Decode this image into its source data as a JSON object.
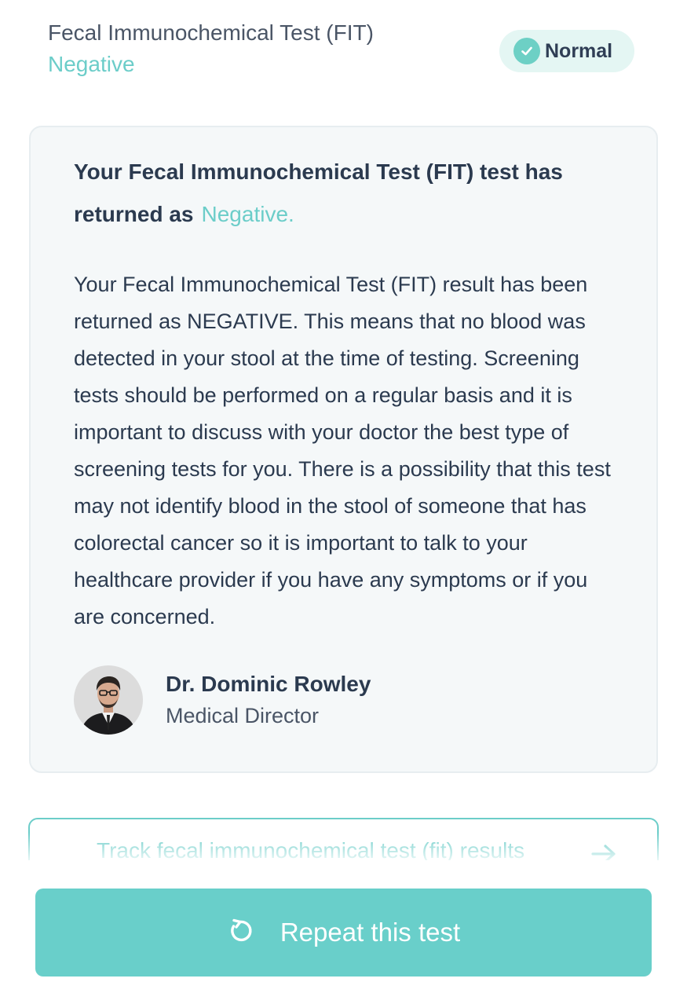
{
  "result_header": {
    "test_name": "Fecal Immunochemical Test (FIT)",
    "result": "Negative",
    "status_badge": "Normal"
  },
  "result_card": {
    "title_prefix": "Your Fecal Immunochemical Test (FIT) test has returned as",
    "title_result": "Negative.",
    "body": "Your Fecal Immunochemical Test (FIT) result has been returned as NEGATIVE. This means that no blood was detected in your stool at the time of testing. Screening tests should be performed on a regular basis and it is important to discuss with your doctor the best type of screening tests for you. There is a possibility that this test may not identify blood in the stool of someone that has colorectal cancer so it is important to talk to your healthcare provider if you have any symptoms or if you are concerned.",
    "doctor": {
      "name": "Dr. Dominic Rowley",
      "role": "Medical Director"
    }
  },
  "actions": {
    "track_label": "Track fecal immunochemical test (fit) results",
    "repeat_label": "Repeat this test"
  },
  "icons": {
    "badge": "check-circle-icon",
    "track": "arrow-right-icon",
    "repeat": "refresh-icon"
  },
  "colors": {
    "accent": "#6ccdc9",
    "badge_bg": "#e4f6f3",
    "card_bg": "#f5f8f9",
    "text_dark": "#2b3a4f",
    "button_bg": "#69cfca"
  }
}
